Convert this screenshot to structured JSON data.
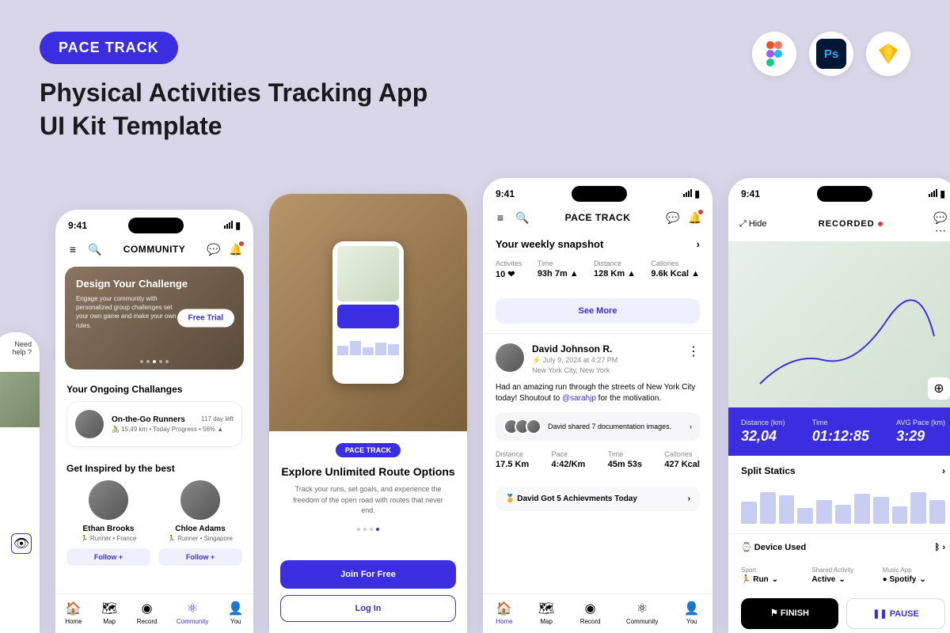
{
  "header": {
    "badge": "PACE TRACK",
    "title_line1": "Physical Activities Tracking App",
    "title_line2": "UI Kit Template"
  },
  "tools": [
    "Figma",
    "Photoshop",
    "Sketch"
  ],
  "status_time": "9:41",
  "phone0": {
    "help": "Need help ?"
  },
  "phone1": {
    "title": "COMMUNITY",
    "hero_title": "Design Your Challenge",
    "hero_desc": "Engage your community with personalized group challenges set your own game and make your own rules.",
    "hero_btn": "Free Trial",
    "ongoing_title": "Your Ongoing Challanges",
    "challenge": {
      "name": "On-the-Go Runners",
      "days": "117 day left",
      "meta": "🚴 15,49 km • Today Progress • 56% ▲"
    },
    "inspired_title": "Get Inspired by the best",
    "people": [
      {
        "name": "Ethan Brooks",
        "meta": "🏃 Runner • France",
        "btn": "Follow +"
      },
      {
        "name": "Chloe Adams",
        "meta": "🏃 Runner • Singapore",
        "btn": "Follow +"
      }
    ],
    "nav": [
      "Home",
      "Map",
      "Record",
      "Community",
      "You"
    ]
  },
  "phone2": {
    "badge": "PACE TRACK",
    "title": "Explore Unlimited Route Options",
    "desc": "Track your runs, set goals, and experience the freedom of the open road with routes that never end.",
    "join": "Join For Free",
    "login": "Log In"
  },
  "phone3": {
    "title": "PACE TRACK",
    "snap_title": "Your weekly snapshot",
    "snap": [
      {
        "label": "Activites",
        "val": "10 ❤"
      },
      {
        "label": "Time",
        "val": "93h 7m ▲"
      },
      {
        "label": "Distance",
        "val": "128 Km ▲"
      },
      {
        "label": "Callories",
        "val": "9.6k Kcal ▲"
      }
    ],
    "see_more": "See More",
    "post": {
      "name": "David Johnson R.",
      "meta": "⚡ July 9, 2024 at 4:27 PM",
      "loc": "New York City, New York",
      "text_before": "Had an amazing run through the streets of New York City today! Shoutout to ",
      "mention": "@sarahjp",
      "text_after": " for the motivation.",
      "shared": "David shared 7 documentation images.",
      "stats": [
        {
          "label": "Distance",
          "val": "17.5 Km"
        },
        {
          "label": "Pace",
          "val": "4:42/Km"
        },
        {
          "label": "Time",
          "val": "45m 53s"
        },
        {
          "label": "Callories",
          "val": "427 Kcal"
        }
      ]
    },
    "achieve": "🏅 David Got 5 Achievments Today",
    "nav": [
      "Home",
      "Map",
      "Record",
      "Community",
      "You"
    ]
  },
  "phone4": {
    "hide": "Hide",
    "title": "RECORDED",
    "stats": [
      {
        "label": "Distance (km)",
        "val": "32,04"
      },
      {
        "label": "Time",
        "val": "01:12:85"
      },
      {
        "label": "AVG Pace (km)",
        "val": "3:29"
      }
    ],
    "split_title": "Split Statics",
    "device": "Device Used",
    "selects": [
      {
        "label": "Sport",
        "val": "🏃 Run"
      },
      {
        "label": "Shared Activity",
        "val": "Active"
      },
      {
        "label": "Music App",
        "val": "● Spotify"
      }
    ],
    "finish": "⚑ FINISH",
    "pause": "❚❚  PAUSE"
  },
  "chart_data": {
    "type": "bar",
    "title": "Split Statics",
    "values": [
      28,
      40,
      36,
      20,
      30,
      24,
      38,
      34,
      22,
      40,
      30
    ]
  }
}
